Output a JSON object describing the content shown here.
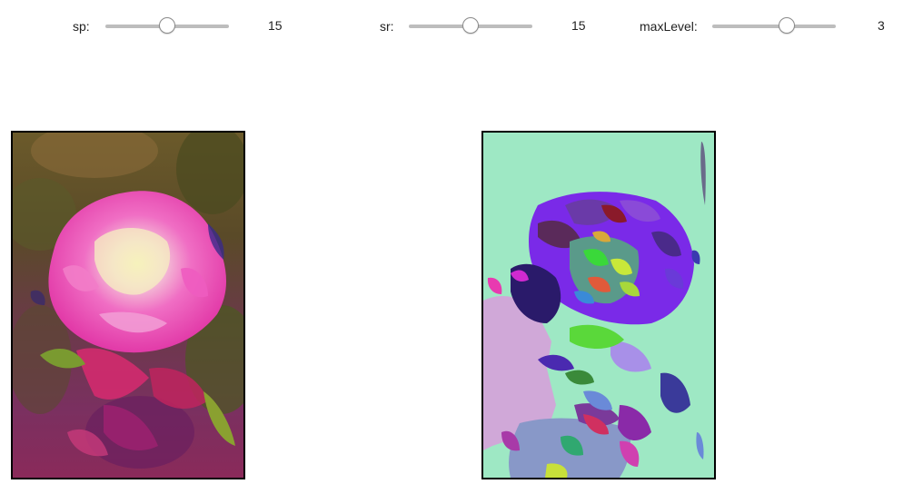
{
  "controls": [
    {
      "label": "sp:",
      "value": "15",
      "fraction": 0.5
    },
    {
      "label": "sr:",
      "value": "15",
      "fraction": 0.5
    },
    {
      "label": "maxLevel:",
      "value": "3",
      "fraction": 0.6
    }
  ],
  "images": {
    "original": {
      "icon": "rose-photo-filtered"
    },
    "segmented": {
      "icon": "rose-segmentation-map"
    }
  },
  "colors": {
    "slider_track": "#bdbdbd",
    "segment_background": "#9ee8c4",
    "image_border": "#000000"
  }
}
